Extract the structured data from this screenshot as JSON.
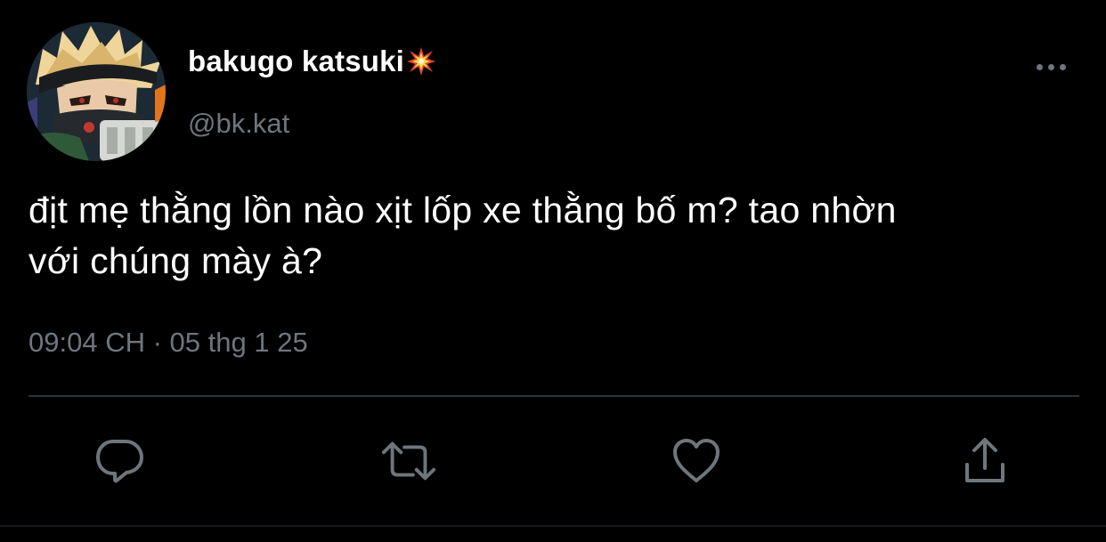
{
  "tweet": {
    "display_name": "bakugo katsuki",
    "name_emoji": "collision-emoji",
    "handle": "@bk.kat",
    "text_line1": "địt mẹ thằng lồn nào xịt lốp xe thằng bố m? tao nhờn",
    "text_line2": "với chúng mày à?",
    "time": "09:04 CH",
    "separator": "·",
    "date": "05 thg 1 25"
  },
  "actions": [
    {
      "icon": "reply-icon"
    },
    {
      "icon": "retweet-icon"
    },
    {
      "icon": "like-icon"
    },
    {
      "icon": "share-icon"
    }
  ],
  "colors": {
    "background": "#000000",
    "primary_text": "#ffffff",
    "secondary_text": "#6e767d",
    "divider": "#2f3336",
    "emoji_red": "#e8452c",
    "emoji_yellow": "#fbd84e"
  }
}
